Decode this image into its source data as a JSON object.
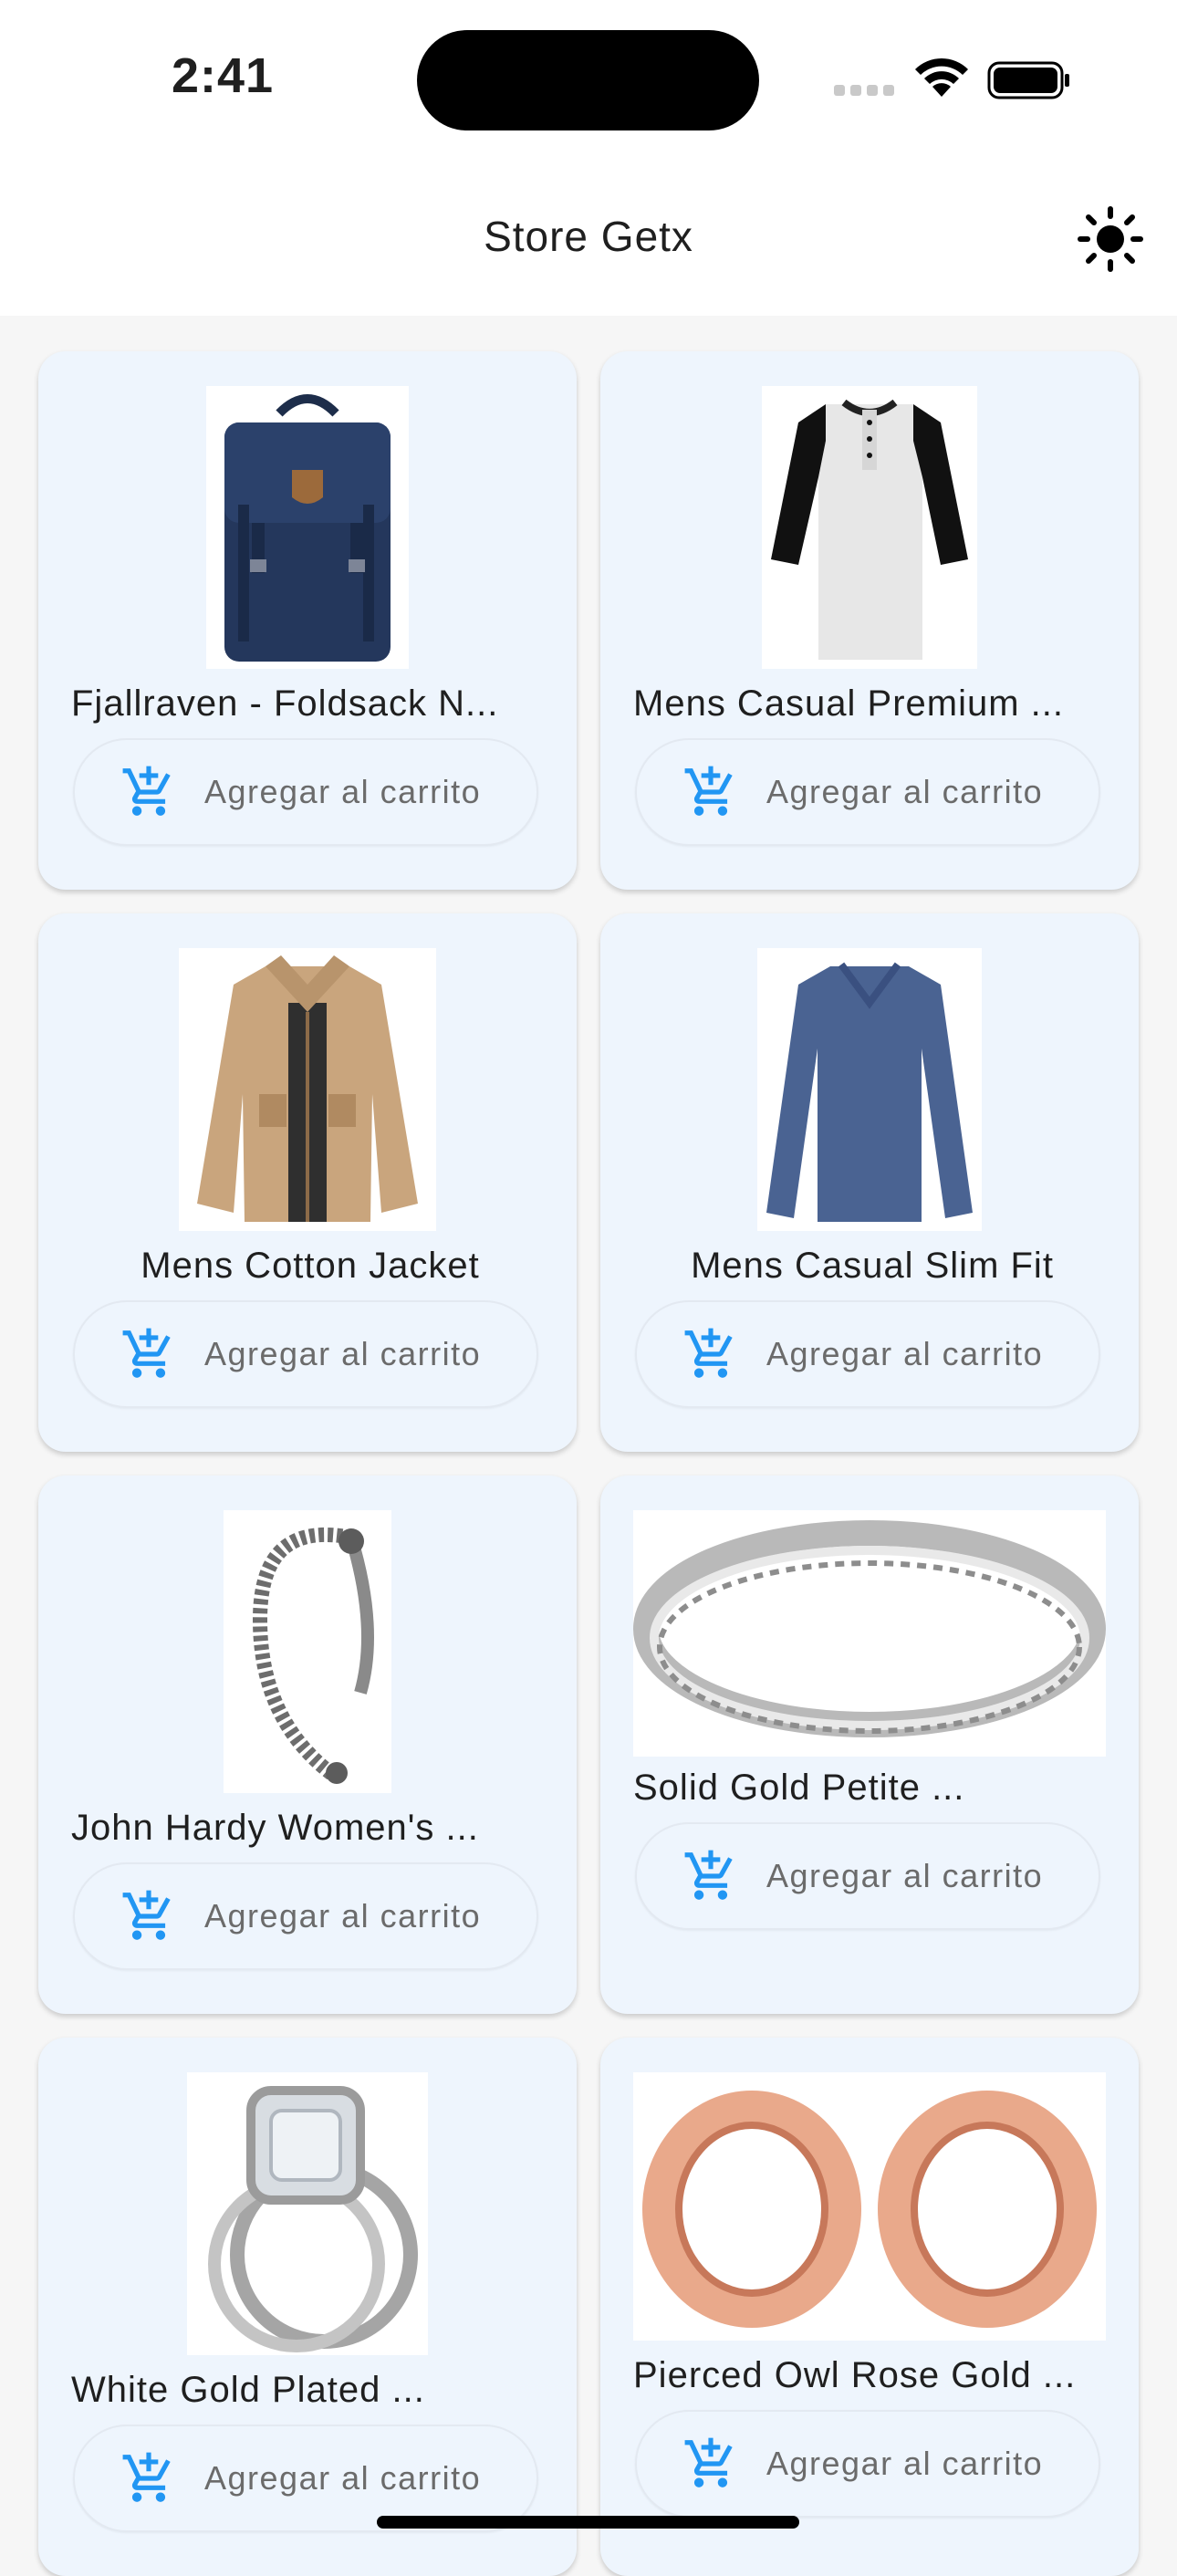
{
  "status_bar": {
    "time": "2:41"
  },
  "app_bar": {
    "title": "Store Getx",
    "theme_icon": "sun-icon"
  },
  "products": [
    {
      "title": "Fjallraven - Foldsack N...",
      "image": "backpack",
      "button_label": "Agregar al carrito"
    },
    {
      "title": "Mens Casual Premium ...",
      "image": "raglan-shirt",
      "button_label": "Agregar al carrito"
    },
    {
      "title": "Mens Cotton Jacket",
      "image": "jacket",
      "button_label": "Agregar al carrito"
    },
    {
      "title": "Mens Casual Slim Fit",
      "image": "long-sleeve-shirt",
      "button_label": "Agregar al carrito"
    },
    {
      "title": "John Hardy Women's ...",
      "image": "bracelet",
      "button_label": "Agregar al carrito"
    },
    {
      "title": "Solid Gold Petite ...",
      "image": "ring",
      "button_label": "Agregar al carrito"
    },
    {
      "title": "White Gold Plated ...",
      "image": "diamond-ring",
      "button_label": "Agregar al carrito"
    },
    {
      "title": "Pierced Owl Rose Gold ...",
      "image": "ear-tunnels",
      "button_label": "Agregar al carrito"
    }
  ],
  "colors": {
    "accent": "#2196f3",
    "card_background": "#eef5fd",
    "page_background": "#f6f6f6"
  }
}
